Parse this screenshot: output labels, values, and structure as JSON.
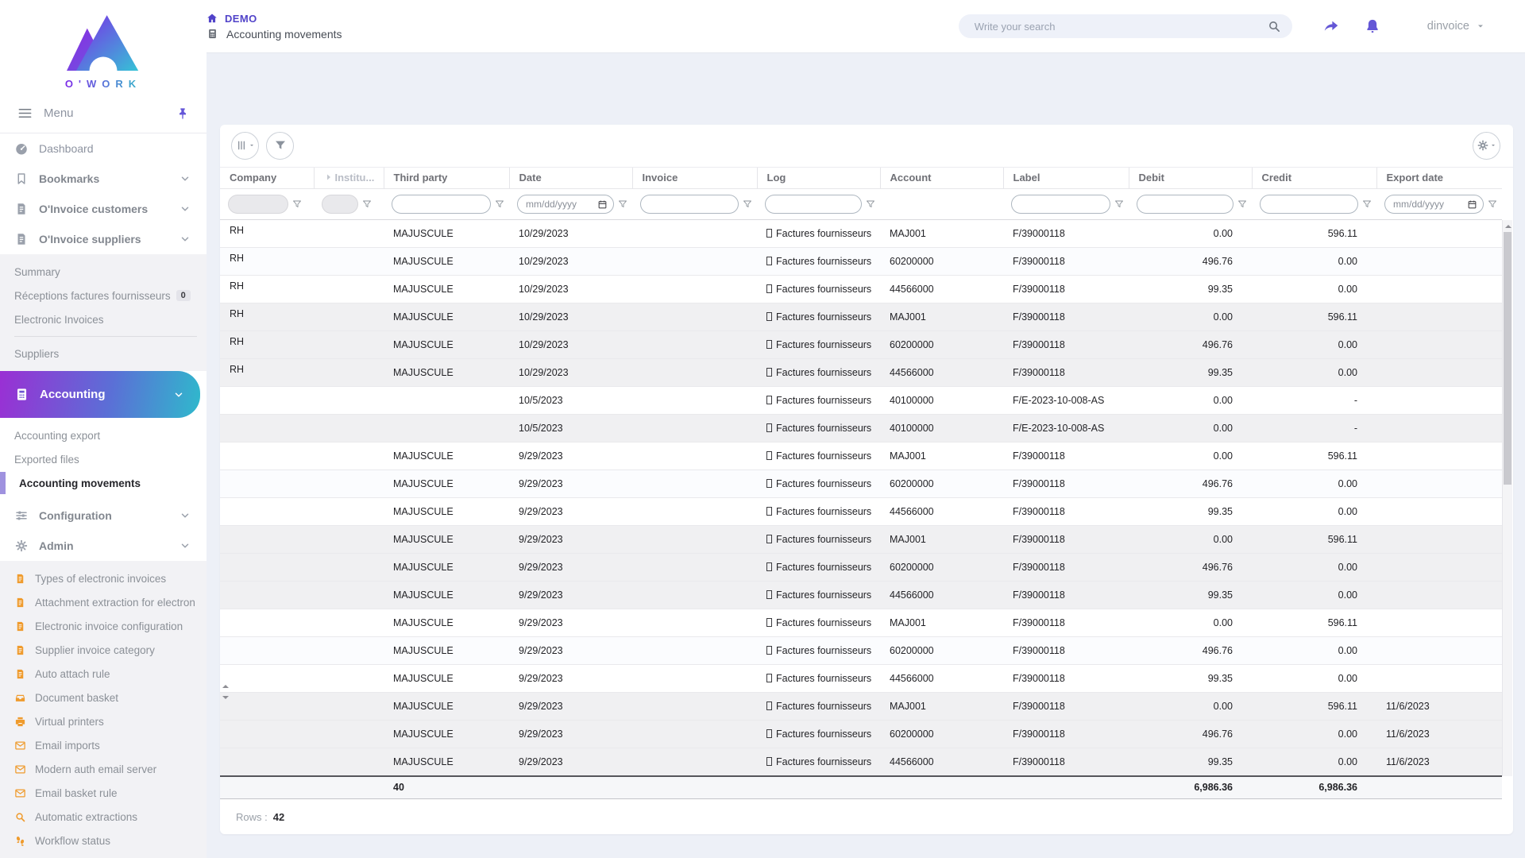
{
  "colors": {
    "accent": "#6456d8",
    "purple_icon": "#6457d6",
    "orange": "#ef9b2d",
    "gradient_start": "#9a2fd4",
    "gradient_end": "#2fb9cc",
    "page_bg": "#edf0f7"
  },
  "brand": {
    "name": "O'WORK"
  },
  "topbar": {
    "breadcrumb_home": "DEMO",
    "page_title": "Accounting movements",
    "search_placeholder": "Write your search",
    "user": "dinvoice"
  },
  "sidebar": {
    "menu_label": "Menu",
    "sections": [
      {
        "type": "item",
        "id": "dashboard",
        "icon": "gauge",
        "label": "Dashboard"
      },
      {
        "type": "item",
        "id": "bookmarks",
        "icon": "bookmark",
        "label": "Bookmarks",
        "bold": true,
        "chevron": true
      },
      {
        "type": "item",
        "id": "oinvoice-customers",
        "icon": "document",
        "label": "O'Invoice customers",
        "bold": true,
        "chevron": true
      },
      {
        "type": "item",
        "id": "oinvoice-suppliers",
        "icon": "document",
        "label": "O'Invoice suppliers",
        "bold": true,
        "chevron": true
      },
      {
        "type": "submenu",
        "id": "suppliers-sub",
        "items": [
          {
            "id": "summary",
            "label": "Summary"
          },
          {
            "id": "receptions-factures-fournisseurs",
            "label": "Réceptions factures fournisseurs",
            "badge": "0"
          },
          {
            "id": "electronic-invoices",
            "label": "Electronic Invoices"
          },
          {
            "divider": true
          },
          {
            "id": "suppliers",
            "label": "Suppliers"
          }
        ]
      },
      {
        "type": "accent",
        "id": "accounting",
        "icon": "calculator",
        "label": "Accounting",
        "chevron": true
      },
      {
        "type": "submenu",
        "id": "accounting-sub",
        "white": true,
        "items": [
          {
            "id": "accounting-export",
            "label": "Accounting export"
          },
          {
            "id": "exported-files",
            "label": "Exported files"
          },
          {
            "id": "accounting-movements",
            "label": "Accounting movements",
            "active": true
          }
        ]
      },
      {
        "type": "item",
        "id": "configuration",
        "icon": "sliders",
        "label": "Configuration",
        "bold": true,
        "chevron": true
      },
      {
        "type": "item",
        "id": "admin",
        "icon": "gear",
        "label": "Admin",
        "bold": true,
        "chevron": true
      },
      {
        "type": "submenu",
        "id": "admin-sub",
        "orange": true,
        "items": [
          {
            "id": "types-of-electronic-invoices",
            "icon": "document",
            "label": "Types of electronic invoices"
          },
          {
            "id": "attachment-extraction",
            "icon": "document",
            "label": "Attachment extraction for electron"
          },
          {
            "id": "electronic-invoice-configuration",
            "icon": "document",
            "label": "Electronic invoice configuration"
          },
          {
            "id": "supplier-invoice-category",
            "icon": "document",
            "label": "Supplier invoice category"
          },
          {
            "id": "auto-attach-rule",
            "icon": "document",
            "label": "Auto attach rule"
          },
          {
            "id": "document-basket",
            "icon": "inbox",
            "label": "Document basket"
          },
          {
            "id": "virtual-printers",
            "icon": "printer",
            "label": "Virtual printers"
          },
          {
            "id": "email-imports",
            "icon": "envelope",
            "label": "Email imports"
          },
          {
            "id": "modern-auth-email-server",
            "icon": "envelope",
            "label": "Modern auth email server"
          },
          {
            "id": "email-basket-rule",
            "icon": "envelope",
            "label": "Email basket rule"
          },
          {
            "id": "automatic-extractions",
            "icon": "magnifier",
            "label": "Automatic extractions"
          },
          {
            "id": "workflow-status",
            "icon": "footprints",
            "label": "Workflow status"
          }
        ]
      }
    ]
  },
  "table": {
    "date_placeholder": "mm/dd/yyyy",
    "columns": [
      {
        "key": "company",
        "label": "Company",
        "filter": "text_disabled"
      },
      {
        "key": "institution",
        "label": "Institu...",
        "filter": "text_disabled_small",
        "muted": true,
        "lead_icon": "chevron-right-solid"
      },
      {
        "key": "third_party",
        "label": "Third party",
        "filter": "text"
      },
      {
        "key": "date",
        "label": "Date",
        "filter": "date"
      },
      {
        "key": "invoice",
        "label": "Invoice",
        "filter": "text"
      },
      {
        "key": "log",
        "label": "Log",
        "filter": "text"
      },
      {
        "key": "account",
        "label": "Account",
        "filter": "none"
      },
      {
        "key": "label",
        "label": "Label",
        "filter": "text"
      },
      {
        "key": "debit",
        "label": "Debit",
        "filter": "text",
        "align": "right"
      },
      {
        "key": "credit",
        "label": "Credit",
        "filter": "text",
        "align": "right"
      },
      {
        "key": "export_date",
        "label": "Export date",
        "filter": "date"
      }
    ],
    "rows": [
      {
        "company": "RH",
        "institution": "",
        "third_party": "MAJUSCULE",
        "date": "10/29/2023",
        "invoice": "",
        "log": "Factures fournisseurs",
        "account": "MAJ001",
        "label": "F/39000118",
        "debit": "0.00",
        "credit": "596.11",
        "export_date": "",
        "shade": "none"
      },
      {
        "company": "RH",
        "institution": "",
        "third_party": "MAJUSCULE",
        "date": "10/29/2023",
        "invoice": "",
        "log": "Factures fournisseurs",
        "account": "60200000",
        "label": "F/39000118",
        "debit": "496.76",
        "credit": "0.00",
        "export_date": "",
        "shade": "tint"
      },
      {
        "company": "RH",
        "institution": "",
        "third_party": "MAJUSCULE",
        "date": "10/29/2023",
        "invoice": "",
        "log": "Factures fournisseurs",
        "account": "44566000",
        "label": "F/39000118",
        "debit": "99.35",
        "credit": "0.00",
        "export_date": "",
        "shade": "none"
      },
      {
        "company": "RH",
        "institution": "",
        "third_party": "MAJUSCULE",
        "date": "10/29/2023",
        "invoice": "",
        "log": "Factures fournisseurs",
        "account": "MAJ001",
        "label": "F/39000118",
        "debit": "0.00",
        "credit": "596.11",
        "export_date": "",
        "shade": "gray"
      },
      {
        "company": "RH",
        "institution": "",
        "third_party": "MAJUSCULE",
        "date": "10/29/2023",
        "invoice": "",
        "log": "Factures fournisseurs",
        "account": "60200000",
        "label": "F/39000118",
        "debit": "496.76",
        "credit": "0.00",
        "export_date": "",
        "shade": "gray"
      },
      {
        "company": "RH",
        "institution": "",
        "third_party": "MAJUSCULE",
        "date": "10/29/2023",
        "invoice": "",
        "log": "Factures fournisseurs",
        "account": "44566000",
        "label": "F/39000118",
        "debit": "99.35",
        "credit": "0.00",
        "export_date": "",
        "shade": "gray"
      },
      {
        "company": "",
        "institution": "",
        "third_party": "",
        "date": "10/5/2023",
        "invoice": "",
        "log": "Factures fournisseurs",
        "account": "40100000",
        "label": "F/E-2023-10-008-AS",
        "debit": "0.00",
        "credit": "-",
        "export_date": "",
        "shade": "none"
      },
      {
        "company": "",
        "institution": "",
        "third_party": "",
        "date": "10/5/2023",
        "invoice": "",
        "log": "Factures fournisseurs",
        "account": "40100000",
        "label": "F/E-2023-10-008-AS",
        "debit": "0.00",
        "credit": "-",
        "export_date": "",
        "shade": "gray"
      },
      {
        "company": "",
        "institution": "",
        "third_party": "MAJUSCULE",
        "date": "9/29/2023",
        "invoice": "",
        "log": "Factures fournisseurs",
        "account": "MAJ001",
        "label": "F/39000118",
        "debit": "0.00",
        "credit": "596.11",
        "export_date": "",
        "shade": "none"
      },
      {
        "company": "",
        "institution": "",
        "third_party": "MAJUSCULE",
        "date": "9/29/2023",
        "invoice": "",
        "log": "Factures fournisseurs",
        "account": "60200000",
        "label": "F/39000118",
        "debit": "496.76",
        "credit": "0.00",
        "export_date": "",
        "shade": "tint"
      },
      {
        "company": "",
        "institution": "",
        "third_party": "MAJUSCULE",
        "date": "9/29/2023",
        "invoice": "",
        "log": "Factures fournisseurs",
        "account": "44566000",
        "label": "F/39000118",
        "debit": "99.35",
        "credit": "0.00",
        "export_date": "",
        "shade": "none"
      },
      {
        "company": "",
        "institution": "",
        "third_party": "MAJUSCULE",
        "date": "9/29/2023",
        "invoice": "",
        "log": "Factures fournisseurs",
        "account": "MAJ001",
        "label": "F/39000118",
        "debit": "0.00",
        "credit": "596.11",
        "export_date": "",
        "shade": "gray"
      },
      {
        "company": "",
        "institution": "",
        "third_party": "MAJUSCULE",
        "date": "9/29/2023",
        "invoice": "",
        "log": "Factures fournisseurs",
        "account": "60200000",
        "label": "F/39000118",
        "debit": "496.76",
        "credit": "0.00",
        "export_date": "",
        "shade": "gray"
      },
      {
        "company": "",
        "institution": "",
        "third_party": "MAJUSCULE",
        "date": "9/29/2023",
        "invoice": "",
        "log": "Factures fournisseurs",
        "account": "44566000",
        "label": "F/39000118",
        "debit": "99.35",
        "credit": "0.00",
        "export_date": "",
        "shade": "gray"
      },
      {
        "company": "",
        "institution": "",
        "third_party": "MAJUSCULE",
        "date": "9/29/2023",
        "invoice": "",
        "log": "Factures fournisseurs",
        "account": "MAJ001",
        "label": "F/39000118",
        "debit": "0.00",
        "credit": "596.11",
        "export_date": "",
        "shade": "none"
      },
      {
        "company": "",
        "institution": "",
        "third_party": "MAJUSCULE",
        "date": "9/29/2023",
        "invoice": "",
        "log": "Factures fournisseurs",
        "account": "60200000",
        "label": "F/39000118",
        "debit": "496.76",
        "credit": "0.00",
        "export_date": "",
        "shade": "tint"
      },
      {
        "company": "",
        "institution": "",
        "third_party": "MAJUSCULE",
        "date": "9/29/2023",
        "invoice": "",
        "log": "Factures fournisseurs",
        "account": "44566000",
        "label": "F/39000118",
        "debit": "99.35",
        "credit": "0.00",
        "export_date": "",
        "shade": "none"
      },
      {
        "company": "",
        "institution": "",
        "third_party": "MAJUSCULE",
        "date": "9/29/2023",
        "invoice": "",
        "log": "Factures fournisseurs",
        "account": "MAJ001",
        "label": "F/39000118",
        "debit": "0.00",
        "credit": "596.11",
        "export_date": "11/6/2023",
        "shade": "gray"
      },
      {
        "company": "",
        "institution": "",
        "third_party": "MAJUSCULE",
        "date": "9/29/2023",
        "invoice": "",
        "log": "Factures fournisseurs",
        "account": "60200000",
        "label": "F/39000118",
        "debit": "496.76",
        "credit": "0.00",
        "export_date": "11/6/2023",
        "shade": "gray"
      },
      {
        "company": "",
        "institution": "",
        "third_party": "MAJUSCULE",
        "date": "9/29/2023",
        "invoice": "",
        "log": "Factures fournisseurs",
        "account": "44566000",
        "label": "F/39000118",
        "debit": "99.35",
        "credit": "0.00",
        "export_date": "11/6/2023",
        "shade": "gray"
      }
    ],
    "footer": {
      "third_party_count": "40",
      "debit_total": "6,986.36",
      "credit_total": "6,986.36"
    },
    "rows_info": {
      "label": "Rows :",
      "value": "42"
    }
  }
}
